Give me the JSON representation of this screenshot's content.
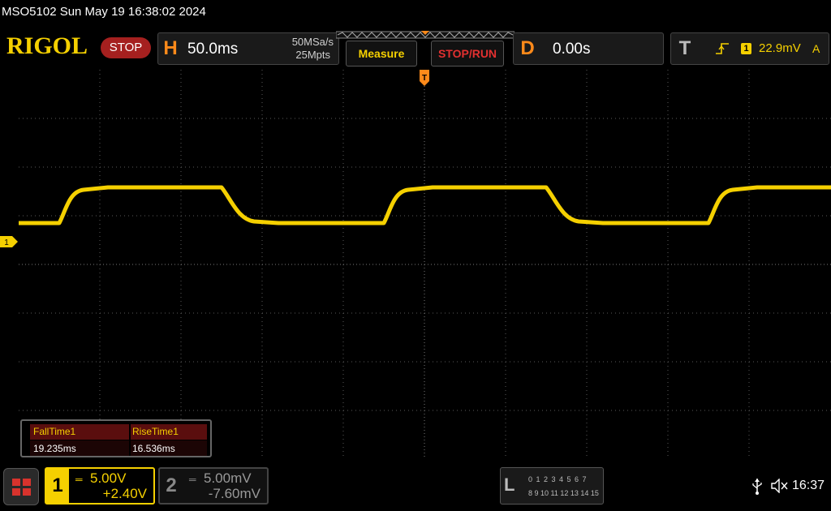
{
  "topline": {
    "title": "MSO5102  Sun May 19 16:38:02 2024"
  },
  "header": {
    "logo": "RIGOL",
    "run_state": "STOP",
    "horizontal": {
      "letter": "H",
      "timebase": "50.0ms",
      "sample_rate": "50MSa/s",
      "memory_depth": "25Mpts"
    },
    "measure_label": "Measure",
    "stoprun_label": "STOP/RUN",
    "delay": {
      "letter": "D",
      "value": "0.00s"
    },
    "trigger": {
      "letter": "T",
      "source": "1",
      "level": "22.9mV",
      "coupling": "A"
    }
  },
  "screen": {
    "ch1_marker": "1",
    "trigger_marker": "T"
  },
  "measurements": {
    "items": [
      {
        "name": "FallTime1",
        "value": "19.235ms"
      },
      {
        "name": "RiseTime1",
        "value": "16.536ms"
      }
    ]
  },
  "channels": [
    {
      "num": "1",
      "scale": "5.00V",
      "offset": "+2.40V",
      "active": true
    },
    {
      "num": "2",
      "scale": "5.00mV",
      "offset": "-7.60mV",
      "active": false
    }
  ],
  "logic": {
    "letter": "L",
    "row1": "0 1 2 3  4 5 6 7",
    "row2": "8 9 10 11 12 13 14 15"
  },
  "status": {
    "time": "16:37"
  },
  "colors": {
    "ch1": "#f5d000",
    "accent": "#ff8a1a",
    "stop": "#a5201f",
    "grid": "#5a5a5a"
  },
  "icons": [
    "usb-icon",
    "speaker-muted-icon",
    "home-grid-icon",
    "rising-edge-icon",
    "dc-coupling-icon"
  ]
}
